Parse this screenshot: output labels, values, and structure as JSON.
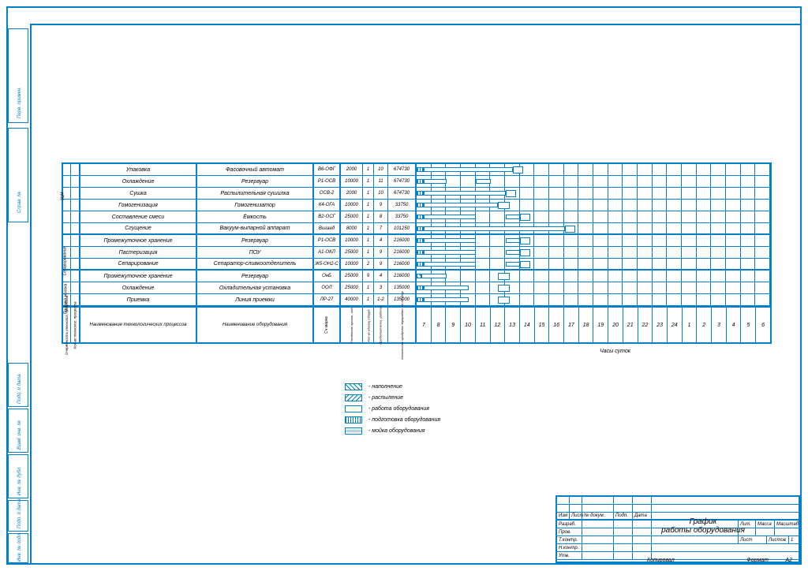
{
  "hours": [
    "7",
    "8",
    "9",
    "10",
    "11",
    "12",
    "13",
    "14",
    "15",
    "16",
    "17",
    "18",
    "19",
    "20",
    "21",
    "22",
    "23",
    "24",
    "1",
    "2",
    "3",
    "4",
    "5",
    "6"
  ],
  "legend": {
    "l1": "- наполнение",
    "l2": "- распыление",
    "l3": "- работа оборудования",
    "l4": "- подготовка оборудования",
    "l5": "- мойка оборудования"
  },
  "axis_label": "Часы суток",
  "header": {
    "proc": "Наименование технологических процессов",
    "equip": "Наименование оборудования",
    "mark": "Сч марка",
    "n1": "Расчётная произв., кг/ч",
    "n2": "Кол-во единиц оборуд.",
    "n3": "Продолжительн. работы",
    "n4": "Количество продукта перерабат. на ед.обор",
    "v1": "Очерёдность технолог. процессов",
    "v2": "Кол-во технолог. процессов"
  },
  "groups": {
    "g1": "ЗЦМ",
    "g2": "Сепарирование",
    "g3": "Приёмка молока"
  },
  "rows": [
    {
      "proc": "Упаковка",
      "equip": "Фасовочный автомат",
      "mark": "В6-ОФГ",
      "n1": "2000",
      "n2": "1",
      "n3": "10",
      "n4": "674730"
    },
    {
      "proc": "Охлаждение",
      "equip": "Резервуар",
      "mark": "Р1-ОСВ",
      "n1": "10000",
      "n2": "1",
      "n3": "11",
      "n4": "674730"
    },
    {
      "proc": "Сушка",
      "equip": "Распылительная сушилка",
      "mark": "ОСВ-2",
      "n1": "2000",
      "n2": "1",
      "n3": "10",
      "n4": "674730"
    },
    {
      "proc": "Гомогенизация",
      "equip": "Гомогенизатор",
      "mark": "К4-ОГА",
      "n1": "10000",
      "n2": "1",
      "n3": "9",
      "n4": "33750"
    },
    {
      "proc": "Составление смеси",
      "equip": "Ёмкость",
      "mark": "В2-ОСГ",
      "n1": "25000",
      "n2": "1",
      "n3": "8",
      "n4": "33750"
    },
    {
      "proc": "Сгущение",
      "equip": "Вакуум-выпарной аппарат",
      "mark": "Виганд",
      "n1": "8000",
      "n2": "1",
      "n3": "7",
      "n4": "101250"
    },
    {
      "proc": "Промежуточное хранение",
      "equip": "Резервуар",
      "mark": "Р1-ОСВ",
      "n1": "10000",
      "n2": "1",
      "n3": "4",
      "n4": "216000"
    },
    {
      "proc": "Пастеризация",
      "equip": "ПОУ",
      "mark": "А1-ОКЛ",
      "n1": "25000",
      "n2": "1",
      "n3": "9",
      "n4": "216000"
    },
    {
      "proc": "Сепарирование",
      "equip": "Сепаратор-сливкоотделитель",
      "mark": "Ж5-ОН2-С",
      "n1": "10000",
      "n2": "2",
      "n3": "9",
      "n4": "216000"
    },
    {
      "proc": "Промежуточное хранение",
      "equip": "Резервуар",
      "mark": "ОнБ",
      "n1": "25000",
      "n2": "9",
      "n3": "4",
      "n4": "216000"
    },
    {
      "proc": "Охлаждение",
      "equip": "Охладительная установка",
      "mark": "ООЛ",
      "n1": "25000",
      "n2": "1",
      "n3": "3",
      "n4": "135000"
    },
    {
      "proc": "Приемка",
      "equip": "Линия приемки",
      "mark": "ЛР-27",
      "n1": "40000",
      "n2": "1",
      "n3": "1-2",
      "n4": "135000"
    }
  ],
  "chart_data": {
    "type": "gantt-like",
    "comment": "bars start/end in hour-units (0=7:00). Approximate from drawing.",
    "bars": [
      {
        "row": 0,
        "segs": [
          [
            0,
            0.5,
            "striped"
          ],
          [
            0.5,
            6.5,
            "plain"
          ],
          [
            6.5,
            7.2,
            "double"
          ]
        ]
      },
      {
        "row": 1,
        "segs": [
          [
            0,
            0.5,
            "striped"
          ],
          [
            0.5,
            2,
            "plain"
          ],
          [
            4,
            5,
            "plain"
          ]
        ]
      },
      {
        "row": 2,
        "segs": [
          [
            0,
            0.5,
            "striped"
          ],
          [
            0.5,
            6,
            "plain"
          ],
          [
            6,
            6.7,
            "double"
          ]
        ]
      },
      {
        "row": 3,
        "segs": [
          [
            0,
            0.5,
            "striped"
          ],
          [
            0.5,
            5.5,
            "plain"
          ],
          [
            5.5,
            6.3,
            "double"
          ]
        ]
      },
      {
        "row": 4,
        "segs": [
          [
            0,
            0.5,
            "striped"
          ],
          [
            0.5,
            4,
            "plain"
          ],
          [
            6,
            7,
            "plain"
          ],
          [
            7,
            7.7,
            "double"
          ]
        ]
      },
      {
        "row": 5,
        "segs": [
          [
            0,
            0.5,
            "striped"
          ],
          [
            0.5,
            10,
            "plain"
          ],
          [
            10,
            10.7,
            "double"
          ]
        ]
      },
      {
        "row": 6,
        "segs": [
          [
            0,
            0.5,
            "striped"
          ],
          [
            0.5,
            4,
            "plain"
          ],
          [
            6,
            7,
            "plain"
          ],
          [
            7,
            7.7,
            "double"
          ]
        ]
      },
      {
        "row": 7,
        "segs": [
          [
            0,
            0.5,
            "striped"
          ],
          [
            0.5,
            4,
            "plain"
          ],
          [
            6,
            7,
            "plain"
          ],
          [
            7,
            7.7,
            "double"
          ]
        ]
      },
      {
        "row": 8,
        "segs": [
          [
            0,
            0.5,
            "striped"
          ],
          [
            0.5,
            4,
            "plain"
          ],
          [
            6,
            7,
            "plain"
          ],
          [
            7,
            7.7,
            "double"
          ]
        ]
      },
      {
        "row": 9,
        "segs": [
          [
            0,
            0.3,
            "hatch"
          ],
          [
            0.3,
            2,
            "plain"
          ],
          [
            5.5,
            6.3,
            "double"
          ]
        ]
      },
      {
        "row": 10,
        "segs": [
          [
            0,
            0.5,
            "striped"
          ],
          [
            0.5,
            3.5,
            "plain"
          ],
          [
            5.5,
            6.3,
            "double"
          ]
        ]
      },
      {
        "row": 11,
        "segs": [
          [
            0,
            0.5,
            "striped"
          ],
          [
            0.5,
            3.5,
            "plain"
          ],
          [
            5.5,
            6.3,
            "double"
          ]
        ]
      }
    ]
  },
  "title_block": {
    "title": "График\nработы оборудования",
    "cells": [
      "Изм",
      "Лист",
      "№ докум.",
      "Подп.",
      "Дата",
      "Разраб.",
      "Пров.",
      "Т.контр.",
      "Н.контр.",
      "Утв.",
      "Лит.",
      "Масса",
      "Масштаб",
      "Лист",
      "Листов",
      "1"
    ],
    "format": "Формат",
    "fval": "А2",
    "copied": "Копировал"
  },
  "binding_labels": [
    "Перв. примен.",
    "Справ. №",
    "Подп. и дата",
    "Взам. инв. №",
    "Инв. № дубл.",
    "Подп. и дата",
    "Инв. № подл."
  ]
}
